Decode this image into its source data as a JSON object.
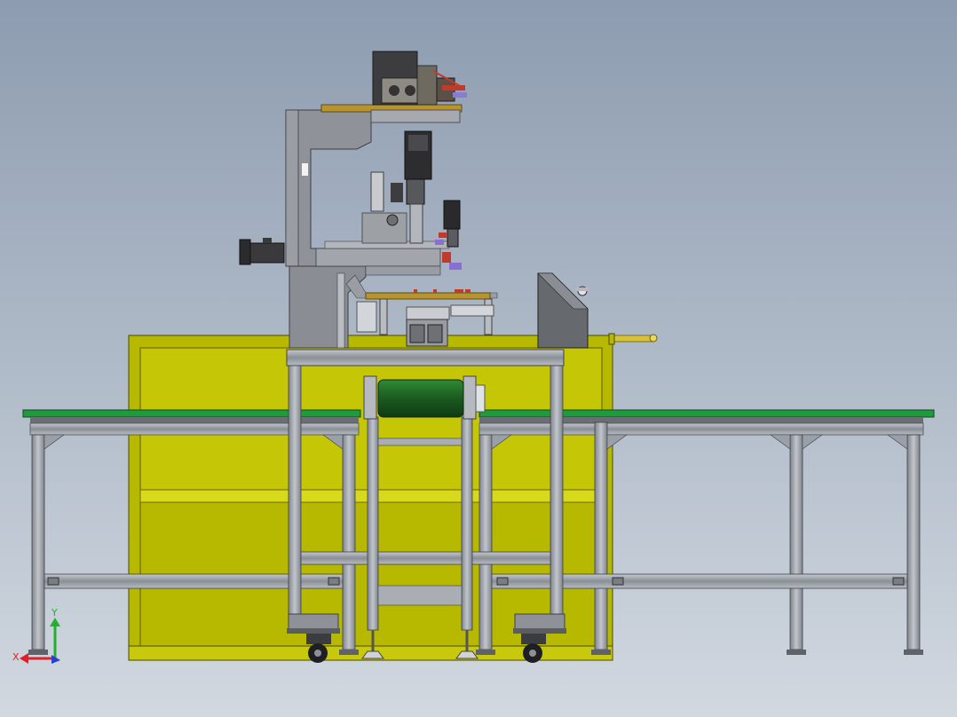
{
  "triad": {
    "x_label": "X",
    "y_label": "Y",
    "x_color": "#e0202a",
    "y_color": "#23b02f",
    "z_color": "#2a3fd0"
  },
  "colors": {
    "bg_top": "#8d9cb0",
    "bg_bottom": "#cfd6df",
    "frame_yellow": "#b7b800",
    "frame_yellow_light": "#d3d40a",
    "conveyor_green": "#1f9a3c",
    "roller_green": "#1f6b25",
    "aluminum": "#a9adb4",
    "machine_gray": "#8c8f96",
    "dark_part": "#3d3d40",
    "accent_red": "#c03b2b",
    "brass": "#d7c33a"
  }
}
